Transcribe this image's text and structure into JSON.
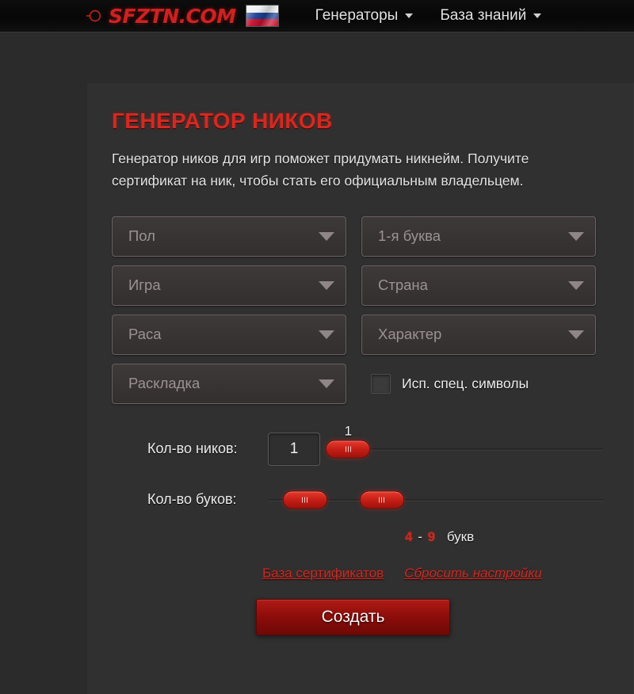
{
  "header": {
    "brand": {
      "icon": "crosshair-icon",
      "text": "SFZTN.COM"
    },
    "flag": {
      "icon": "russian-flag-icon",
      "alt": "Россия"
    },
    "nav": [
      {
        "label": "Генераторы",
        "caret": "chevron-down-icon"
      },
      {
        "label": "База знаний",
        "caret": "chevron-down-icon"
      }
    ]
  },
  "main": {
    "title": "ГЕНЕРАТОР НИКОВ",
    "description": "Генератор ников для игр поможет придумать никнейм. Получите сертификат на ник, чтобы стать его официальным владельцем.",
    "selects": [
      {
        "name": "gender",
        "placeholder": "Пол",
        "value": ""
      },
      {
        "name": "letter",
        "placeholder": "1-я буква",
        "value": ""
      },
      {
        "name": "game",
        "placeholder": "Игра",
        "value": ""
      },
      {
        "name": "country",
        "placeholder": "Страна",
        "value": ""
      },
      {
        "name": "race",
        "placeholder": "Раса",
        "value": ""
      },
      {
        "name": "nature",
        "placeholder": "Характер",
        "value": ""
      },
      {
        "name": "layout",
        "placeholder": "Раскладка",
        "value": ""
      }
    ],
    "checkbox": {
      "label": "Исп. спец. символы",
      "checked": false
    },
    "sliders": {
      "nick_count": {
        "label": "Кол-во ников:",
        "value": "1",
        "handle_value": "1",
        "min": 1,
        "max": 20,
        "handle_percent": 4
      },
      "letter_count": {
        "label": "Кол-во буков:",
        "min_value": "4",
        "max_value": "9",
        "min": 2,
        "max": 20,
        "handle_min_percent": 11,
        "handle_max_percent": 34
      }
    },
    "range_caption": {
      "min": "4",
      "dash": "-",
      "max": "9",
      "word": "букв"
    },
    "links": [
      {
        "name": "certificates-database",
        "label": "База сертификатов",
        "italic": false
      },
      {
        "name": "reset-settings",
        "label": "Сбросить настройки",
        "italic": true
      }
    ],
    "create_button": {
      "label": "Создать"
    }
  },
  "colors": {
    "accent_red": "#cc2222",
    "title_red": "#d12a22",
    "link_red": "#c0302a",
    "button_red": "#8c0d0a",
    "page_bg": "#2b2b2b",
    "panel_bg": "#303030",
    "header_bg": "#0b0b0b",
    "select_bg": "#393434",
    "select_border": "#6a6060",
    "placeholder_text": "#9b9292",
    "body_text": "#e3e3e3"
  }
}
